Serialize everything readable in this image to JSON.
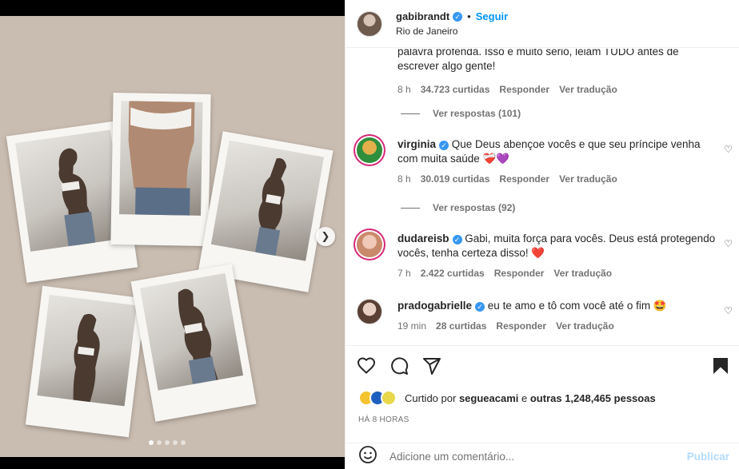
{
  "header": {
    "username": "gabibrandt",
    "separator": "•",
    "follow_label": "Seguir",
    "location": "Rio de Janeiro"
  },
  "comments": {
    "first_partial_text_line1": "palavra profenda. Isso é muito sério, leiam TUDO antes de",
    "first_partial_text_line2": "escrever algo gente!",
    "first_time": "8 h",
    "first_likes": "34.723 curtidas",
    "reply_label": "Responder",
    "translate_label": "Ver tradução",
    "view_replies_1": "Ver respostas (101)",
    "items": [
      {
        "user": "virginia",
        "text": "Que Deus abençoe vocês e que seu príncipe venha com muita saúde",
        "emoji": "❤️‍🩹💜",
        "time": "8 h",
        "likes": "30.019 curtidas"
      },
      {
        "user": "dudareisb",
        "text": "Gabi, muita força para vocês. Deus está protegendo vocês, tenha certeza disso!",
        "emoji": "❤️",
        "time": "7 h",
        "likes": "2.422 curtidas"
      },
      {
        "user": "pradogabrielle",
        "text": "eu te amo e tô com você até o fim",
        "emoji": "🤩",
        "time": "19 min",
        "likes": "28 curtidas"
      }
    ],
    "view_replies_2": "Ver respostas (92)"
  },
  "likes": {
    "prefix": "Curtido por",
    "user": "segueacami",
    "middle": "e",
    "others": "outras 1,248,465 pessoas"
  },
  "post_time": "HÁ 8 HORAS",
  "add_comment": {
    "placeholder": "Adicione um comentário...",
    "publish_label": "Publicar"
  },
  "icons": {
    "like": "heart-icon",
    "comment": "comment-icon",
    "share": "share-icon",
    "save": "bookmark-icon",
    "emoji": "emoji-icon",
    "next": "chevron-right-icon"
  },
  "colors": {
    "link": "#0095f6",
    "verified": "#3897f0",
    "publish_disabled": "#b3dbff",
    "muted": "#737373"
  },
  "carousel": {
    "slides": 5,
    "active": 1
  }
}
